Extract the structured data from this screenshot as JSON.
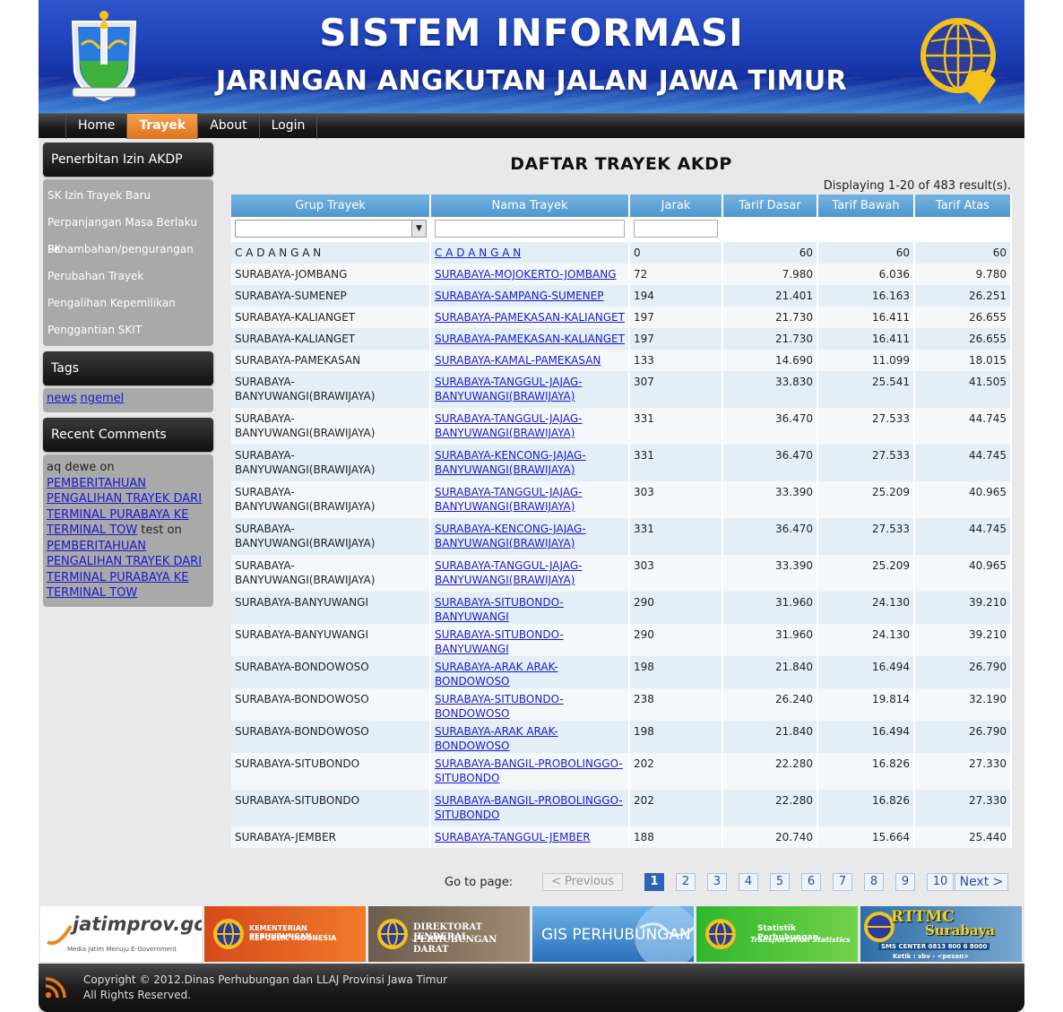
{
  "header": {
    "title": "SISTEM INFORMASI",
    "subtitle": "JARINGAN ANGKUTAN JALAN JAWA TIMUR"
  },
  "nav": {
    "items": [
      {
        "label": "Home",
        "active": false
      },
      {
        "label": "Trayek",
        "active": true
      },
      {
        "label": "About",
        "active": false
      },
      {
        "label": "Login",
        "active": false
      }
    ]
  },
  "sidebar": {
    "izin_title": "Penerbitan Izin AKDP",
    "izin_items": [
      "SK Izin Trayek Baru",
      "Perpanjangan Masa Berlaku SK",
      "Penambahan/pengurangan",
      "Perubahan Trayek",
      "Pengalihan Kepemilikan",
      "Penggantian SKIT"
    ],
    "tags_title": "Tags",
    "tags": [
      "news",
      "ngemel"
    ],
    "comments_title": "Recent Comments",
    "comments": [
      {
        "author": "aq dewe",
        "on": "on",
        "link": "PEMBERITAHUAN PENGALIHAN TRAYEK DARI TERMINAL PURABAYA KE TERMINAL TOW"
      },
      {
        "author": "test",
        "on": "on",
        "link": "PEMBERITAHUAN PENGALIHAN TRAYEK DARI TERMINAL PURABAYA KE TERMINAL TOW"
      }
    ]
  },
  "content": {
    "title": "DAFTAR TRAYEK AKDP",
    "summary": "Displaying 1-20 of 483 result(s).",
    "columns": [
      "Grup Trayek",
      "Nama Trayek",
      "Jarak",
      "Tarif Dasar",
      "Tarif Bawah",
      "Tarif Atas"
    ],
    "rows": [
      {
        "grup": "C A D A N G A N",
        "nama": "C A D A N G A N",
        "jarak": "0",
        "dasar": "60",
        "bawah": "60",
        "atas": "60"
      },
      {
        "grup": "SURABAYA-JOMBANG",
        "nama": "SURABAYA-MOJOKERTO-JOMBANG",
        "jarak": "72",
        "dasar": "7.980",
        "bawah": "6.036",
        "atas": "9.780"
      },
      {
        "grup": "SURABAYA-SUMENEP",
        "nama": "SURABAYA-SAMPANG-SUMENEP",
        "jarak": "194",
        "dasar": "21.401",
        "bawah": "16.163",
        "atas": "26.251"
      },
      {
        "grup": "SURABAYA-KALIANGET",
        "nama": "SURABAYA-PAMEKASAN-KALIANGET",
        "jarak": "197",
        "dasar": "21.730",
        "bawah": "16.411",
        "atas": "26.655"
      },
      {
        "grup": "SURABAYA-KALIANGET",
        "nama": "SURABAYA-PAMEKASAN-KALIANGET",
        "jarak": "197",
        "dasar": "21.730",
        "bawah": "16.411",
        "atas": "26.655"
      },
      {
        "grup": "SURABAYA-PAMEKASAN",
        "nama": "SURABAYA-KAMAL-PAMEKASAN",
        "jarak": "133",
        "dasar": "14.690",
        "bawah": "11.099",
        "atas": "18.015"
      },
      {
        "grup": "SURABAYA-BANYUWANGI(BRAWIJAYA)",
        "nama": "SURABAYA-TANGGUL-JAJAG-BANYUWANGI(BRAWIJAYA)",
        "jarak": "307",
        "dasar": "33.830",
        "bawah": "25.541",
        "atas": "41.505"
      },
      {
        "grup": "SURABAYA-BANYUWANGI(BRAWIJAYA)",
        "nama": "SURABAYA-TANGGUL-JAJAG-BANYUWANGI(BRAWIJAYA)",
        "jarak": "331",
        "dasar": "36.470",
        "bawah": "27.533",
        "atas": "44.745"
      },
      {
        "grup": "SURABAYA-BANYUWANGI(BRAWIJAYA)",
        "nama": "SURABAYA-KENCONG-JAJAG-BANYUWANGI(BRAWIJAYA)",
        "jarak": "331",
        "dasar": "36.470",
        "bawah": "27.533",
        "atas": "44.745"
      },
      {
        "grup": "SURABAYA-BANYUWANGI(BRAWIJAYA)",
        "nama": "SURABAYA-TANGGUL-JAJAG-BANYUWANGI(BRAWIJAYA)",
        "jarak": "303",
        "dasar": "33.390",
        "bawah": "25.209",
        "atas": "40.965"
      },
      {
        "grup": "SURABAYA-BANYUWANGI(BRAWIJAYA)",
        "nama": "SURABAYA-KENCONG-JAJAG-BANYUWANGI(BRAWIJAYA)",
        "jarak": "331",
        "dasar": "36.470",
        "bawah": "27.533",
        "atas": "44.745"
      },
      {
        "grup": "SURABAYA-BANYUWANGI(BRAWIJAYA)",
        "nama": "SURABAYA-TANGGUL-JAJAG-BANYUWANGI(BRAWIJAYA)",
        "jarak": "303",
        "dasar": "33.390",
        "bawah": "25.209",
        "atas": "40.965"
      },
      {
        "grup": "SURABAYA-BANYUWANGI",
        "nama": "SURABAYA-SITUBONDO-BANYUWANGI",
        "jarak": "290",
        "dasar": "31.960",
        "bawah": "24.130",
        "atas": "39.210"
      },
      {
        "grup": "SURABAYA-BANYUWANGI",
        "nama": "SURABAYA-SITUBONDO-BANYUWANGI",
        "jarak": "290",
        "dasar": "31.960",
        "bawah": "24.130",
        "atas": "39.210"
      },
      {
        "grup": "SURABAYA-BONDOWOSO",
        "nama": "SURABAYA-ARAK ARAK-BONDOWOSO",
        "jarak": "198",
        "dasar": "21.840",
        "bawah": "16.494",
        "atas": "26.790"
      },
      {
        "grup": "SURABAYA-BONDOWOSO",
        "nama": "SURABAYA-SITUBONDO-BONDOWOSO",
        "jarak": "238",
        "dasar": "26.240",
        "bawah": "19.814",
        "atas": "32.190"
      },
      {
        "grup": "SURABAYA-BONDOWOSO",
        "nama": "SURABAYA-ARAK ARAK-BONDOWOSO",
        "jarak": "198",
        "dasar": "21.840",
        "bawah": "16.494",
        "atas": "26.790"
      },
      {
        "grup": "SURABAYA-SITUBONDO",
        "nama": "SURABAYA-BANGIL-PROBOLINGGO-SITUBONDO",
        "jarak": "202",
        "dasar": "22.280",
        "bawah": "16.826",
        "atas": "27.330"
      },
      {
        "grup": "SURABAYA-SITUBONDO",
        "nama": "SURABAYA-BANGIL-PROBOLINGGO-SITUBONDO",
        "jarak": "202",
        "dasar": "22.280",
        "bawah": "16.826",
        "atas": "27.330"
      },
      {
        "grup": "SURABAYA-JEMBER",
        "nama": "SURABAYA-TANGGUL-JEMBER",
        "jarak": "188",
        "dasar": "20.740",
        "bawah": "15.664",
        "atas": "25.440"
      }
    ]
  },
  "pager": {
    "goto_label": "Go to page:",
    "prev_label": "< Previous",
    "next_label": "Next >",
    "pages": [
      "1",
      "2",
      "3",
      "4",
      "5",
      "6",
      "7",
      "8",
      "9",
      "10"
    ],
    "current": "1"
  },
  "banners": {
    "jatimprov": "jatimprov.go.id",
    "jatimprov_tag": "Media Jatim Menuju E-Government",
    "kemenhub_1": "KEMENTERIAN PERHUBUNGAN",
    "kemenhub_2": "REPUBLIK INDONESIA",
    "dirjen_1": "DIREKTORAT JENDERAL",
    "dirjen_2": "PERHUBUNGAN DARAT",
    "gis": "GIS PERHUBUNGAN",
    "statistik_1": "Statistik Perhubungan",
    "statistik_2": "Transportation Statistics",
    "rttmc_1": "RTTMC",
    "rttmc_2": "Surabaya",
    "rttmc_sms": "SMS CENTER 0813 800 6 8000",
    "rttmc_ketik": "Ketik : sbv - <pesan>"
  },
  "footer": {
    "copyright": "Copyright © 2012.Dinas Perhubungan dan LLAJ Provinsi Jawa Timur",
    "rights": "All Rights Reserved."
  },
  "colors": {
    "header_blue": "#1c3fb4",
    "nav_active": "#e0721b",
    "table_head": "#4f97d0",
    "link": "#1a1ad0"
  }
}
